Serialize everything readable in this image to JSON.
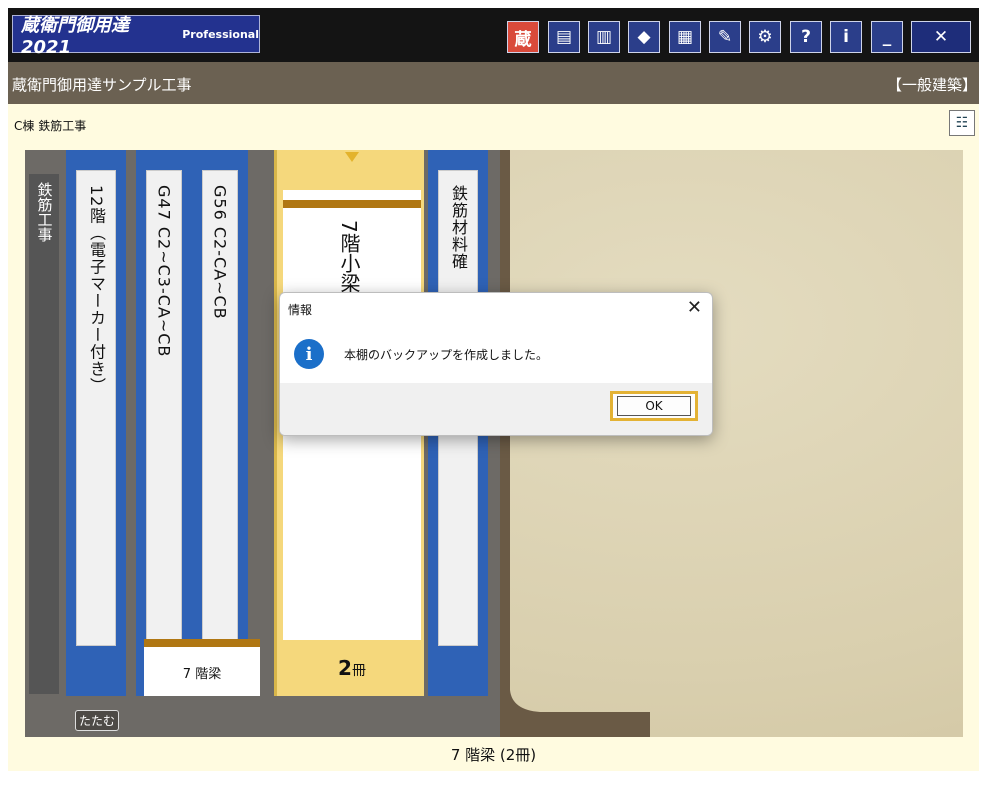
{
  "app": {
    "logo_main": "蔵衛門御用達2021",
    "logo_sub": "Professional",
    "project_name": "蔵衛門御用達サンプル工事",
    "category": "【一般建築】",
    "breadcrumb": "C棟  鉄筋工事",
    "colors": {
      "title_bar": "#141414",
      "project_bar": "#6b6152",
      "binder_blue": "#2f62b6",
      "accent_yellow": "#e3b234"
    }
  },
  "toolbar": {
    "icons": [
      "kura-icon",
      "screen-icon",
      "shelf-icon",
      "arrows-icon",
      "building-icon",
      "pen-icon",
      "gear-icon",
      "help-icon",
      "info-icon",
      "minimize-icon",
      "close-icon"
    ]
  },
  "shelf": {
    "section_tab": "鉄筋工事",
    "binders": [
      {
        "label": "12階（電子マーカー付き）"
      },
      {
        "label": "G47 C2~C3-CA~CB"
      },
      {
        "label": "G56 C2-CA~CB"
      },
      {
        "label": "鉄筋材料確"
      }
    ],
    "open_binder": {
      "title": "7階小梁",
      "count_num": "2",
      "count_unit": "冊"
    },
    "sub_card": "7 階梁",
    "fold_button": "たたむ"
  },
  "status": {
    "text": "7 階梁 (2冊)"
  },
  "dialog": {
    "title": "情報",
    "message": "本棚のバックアップを作成しました。",
    "ok_label": "OK"
  }
}
